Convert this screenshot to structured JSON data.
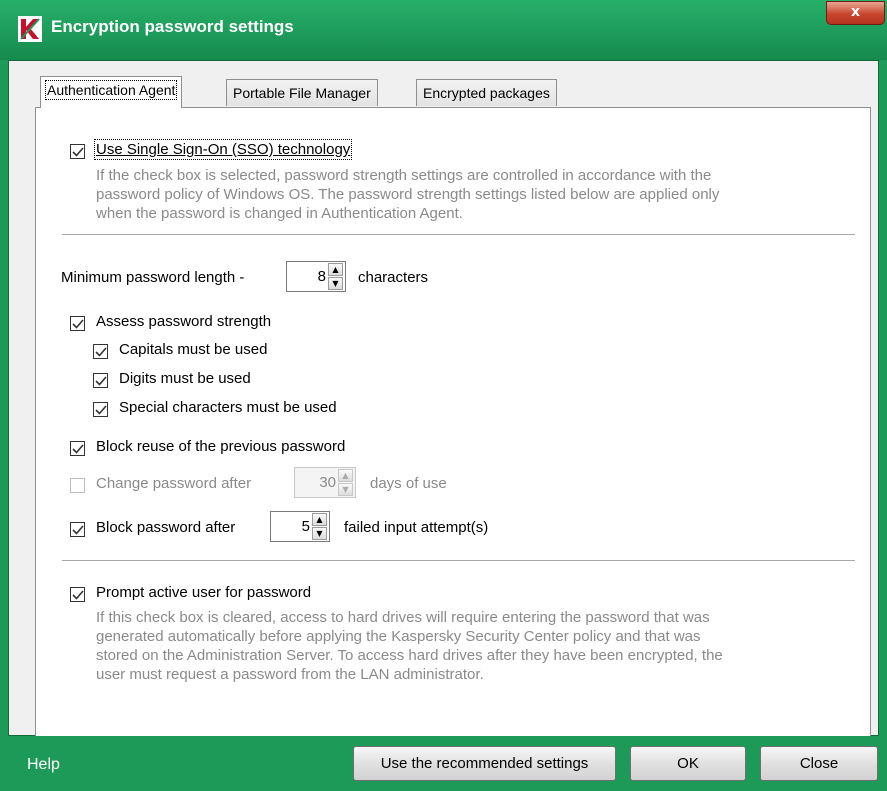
{
  "window": {
    "title": "Encryption password settings",
    "close_label": "x"
  },
  "tabs": [
    {
      "label": "Authentication Agent",
      "active": true
    },
    {
      "label": "Portable File Manager",
      "active": false
    },
    {
      "label": "Encrypted packages",
      "active": false
    }
  ],
  "sso": {
    "label": "Use Single Sign-On (SSO) technology",
    "checked": true,
    "description": [
      "If the check box is selected, password strength settings are controlled in accordance with the",
      "password policy of Windows OS. The password strength settings listed below are applied only",
      "when the password is changed in Authentication Agent."
    ]
  },
  "min_length": {
    "label_before": "Minimum password length -",
    "value": "8",
    "label_after": "characters"
  },
  "assess": {
    "label": "Assess password strength",
    "checked": true,
    "options": [
      {
        "label": "Capitals must be used",
        "checked": true
      },
      {
        "label": "Digits must be used",
        "checked": true
      },
      {
        "label": "Special characters must be used",
        "checked": true
      }
    ]
  },
  "block_reuse": {
    "label": "Block reuse of the previous password",
    "checked": true
  },
  "change_after": {
    "label_before": "Change password after",
    "value": "30",
    "label_after": "days of use",
    "checked": false,
    "enabled": false
  },
  "block_after": {
    "label_before": "Block password after",
    "value": "5",
    "label_after": "failed input attempt(s)",
    "checked": true
  },
  "prompt": {
    "label": "Prompt active user for password",
    "checked": true,
    "description": [
      "If this check box is cleared, access to hard drives will require entering the password that was",
      "generated automatically before applying the Kaspersky Security Center policy and that was",
      "stored on the Administration Server. To access hard drives after they have been encrypted, the",
      "user must request a password from the LAN administrator."
    ]
  },
  "footer": {
    "help": "Help",
    "recommended": "Use the recommended settings",
    "ok": "OK",
    "close": "Close"
  },
  "colors": {
    "frame": "#1e9a58",
    "brand_icon": "#c8102e"
  }
}
